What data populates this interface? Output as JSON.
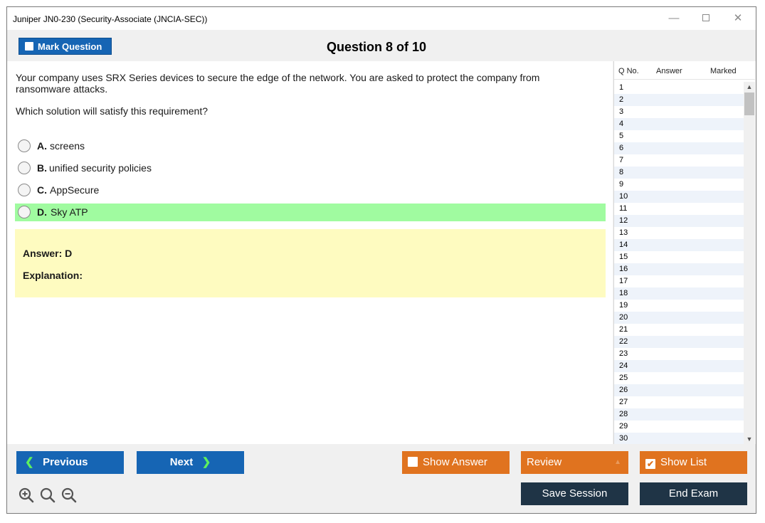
{
  "window": {
    "title": "Juniper JN0-230 (Security-Associate (JNCIA-SEC))",
    "min_glyph": "—",
    "close_glyph": "✕"
  },
  "header": {
    "mark_label": "Mark Question",
    "question_title": "Question 8 of 10"
  },
  "question": {
    "text": "Your company uses SRX Series devices to secure the edge of the network. You are asked to protect the company from ransomware attacks.",
    "prompt": "Which solution will satisfy this requirement?",
    "options": [
      {
        "letter": "A.",
        "text": "screens",
        "correct": false
      },
      {
        "letter": "B.",
        "text": "unified security policies",
        "correct": false
      },
      {
        "letter": "C.",
        "text": "AppSecure",
        "correct": false
      },
      {
        "letter": "D.",
        "text": "Sky ATP",
        "correct": true
      }
    ],
    "answer_label": "Answer: D",
    "explanation_label": "Explanation:"
  },
  "question_list": {
    "headers": {
      "qno": "Q No.",
      "answer": "Answer",
      "marked": "Marked"
    },
    "rows": [
      "1",
      "2",
      "3",
      "4",
      "5",
      "6",
      "7",
      "8",
      "9",
      "10",
      "11",
      "12",
      "13",
      "14",
      "15",
      "16",
      "17",
      "18",
      "19",
      "20",
      "21",
      "22",
      "23",
      "24",
      "25",
      "26",
      "27",
      "28",
      "29",
      "30"
    ]
  },
  "footer": {
    "previous_label": "Previous",
    "next_label": "Next",
    "show_answer_label": "Show Answer",
    "review_label": "Review",
    "show_list_label": "Show List",
    "save_session_label": "Save Session",
    "end_exam_label": "End Exam"
  },
  "colors": {
    "primary_blue": "#1665b4",
    "orange": "#e0731f",
    "dark_navy": "#1f3446",
    "correct_green": "#a0fba0",
    "answer_yellow": "#fefbc0"
  },
  "icons": {
    "zoom_in": "zoom-in-icon",
    "zoom_reset": "zoom-reset-icon",
    "zoom_out": "zoom-out-icon"
  }
}
